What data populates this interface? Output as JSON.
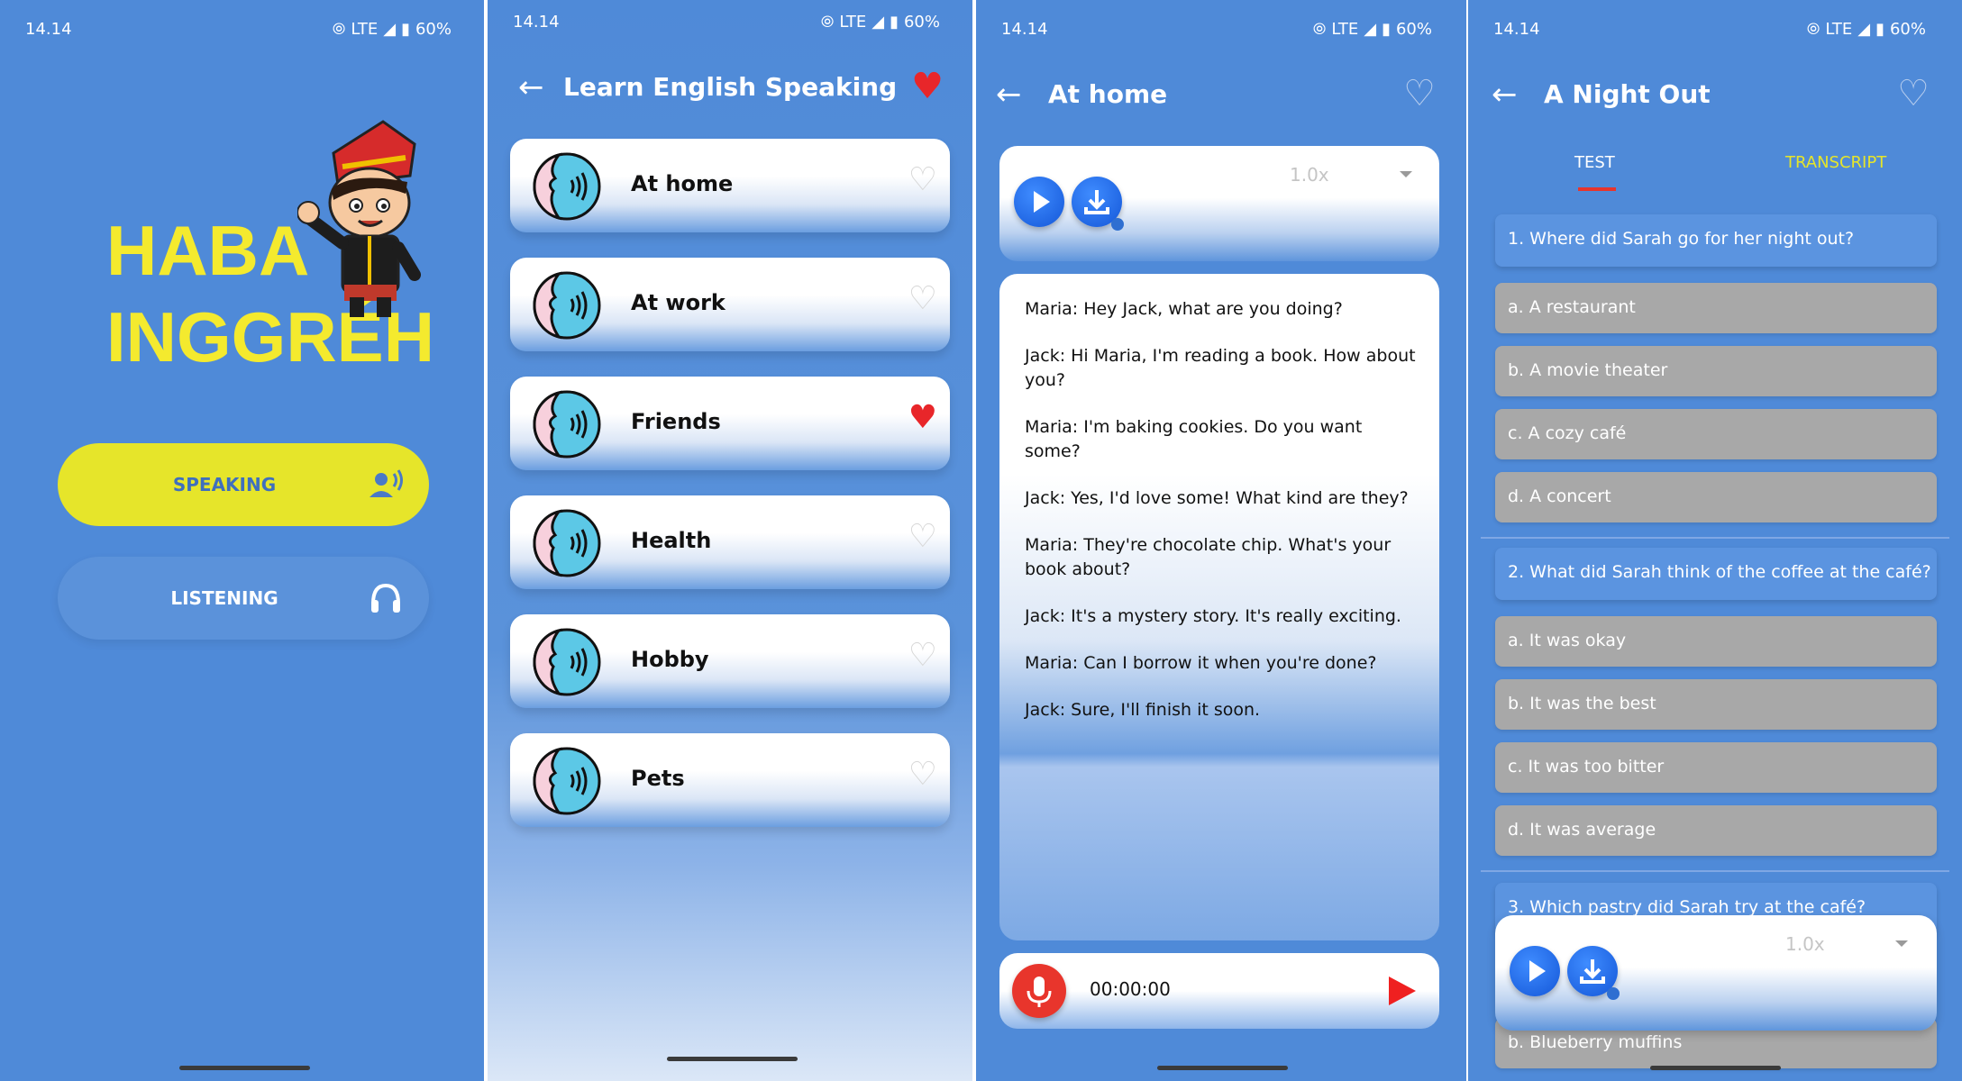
{
  "status_bar": {
    "time": "14.14",
    "network": "LTE",
    "battery": "60%"
  },
  "home": {
    "brand_line1": "HABA",
    "brand_line2": "INGGRÉH",
    "speaking_label": "SPEAKING",
    "listening_label": "LISTENING",
    "speaking_icon": "speaker-voice-icon",
    "listening_icon": "headphones-icon",
    "colors": {
      "accent_yellow": "#e6e52a",
      "background": "#4f8ad8"
    }
  },
  "topics": {
    "title": "Learn English Speaking",
    "items": [
      {
        "label": "At home",
        "favorite": false
      },
      {
        "label": "At work",
        "favorite": false
      },
      {
        "label": "Friends",
        "favorite": true
      },
      {
        "label": "Health",
        "favorite": false
      },
      {
        "label": "Hobby",
        "favorite": false
      },
      {
        "label": "Pets",
        "favorite": false
      }
    ]
  },
  "lesson": {
    "title": "At home",
    "speed": "1.0x",
    "dialogue": [
      "Maria: Hey Jack, what are you doing?",
      "Jack: Hi Maria, I'm reading a book. How about you?",
      "Maria: I'm baking cookies. Do you want some?",
      "Jack: Yes, I'd love some! What kind are they?",
      "Maria: They're chocolate chip. What's your book about?",
      "Jack: It's a mystery story. It's really exciting.",
      "Maria: Can I borrow it when you're done?",
      "Jack: Sure, I'll finish it soon."
    ],
    "recorder_time": "00:00:00"
  },
  "quiz": {
    "title": "A Night Out",
    "tab_test": "TEST",
    "tab_transcript": "TRANSCRIPT",
    "speed": "1.0x",
    "q1": {
      "question": "1. Where did Sarah go for her night out?",
      "options": [
        "a. A restaurant",
        "b. A movie theater",
        "c. A cozy café",
        "d. A concert"
      ]
    },
    "q2": {
      "question": "2. What did Sarah think of the coffee at the café?",
      "options": [
        "a. It was okay",
        "b. It was the best",
        "c. It was too bitter",
        "d. It was average"
      ]
    },
    "q3_partial": "3. Which pastry did Sarah try at the café?",
    "q3_option_b": "b. Blueberry muffins"
  }
}
